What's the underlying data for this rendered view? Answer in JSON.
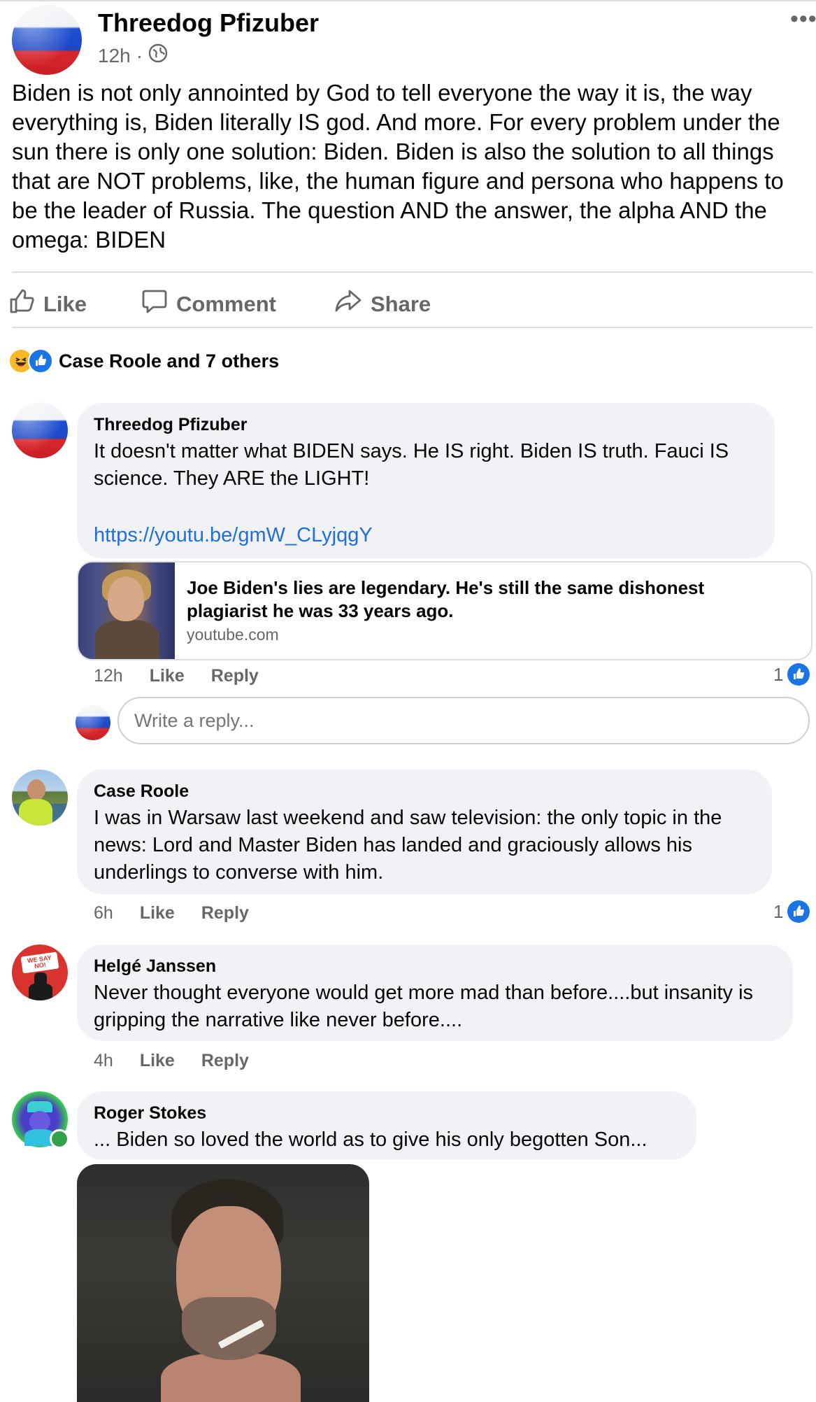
{
  "post": {
    "author": "Threedog Pfizuber",
    "time": "12h",
    "separator": "·",
    "text": "Biden is not only annointed by God to tell everyone the way it is, the way everything is, Biden literally IS god. And more. For every problem under the sun there is only one solution: Biden. Biden is also the solution to all things that are NOT problems, like, the human figure and persona who happens to be the leader of Russia. The question AND the answer, the alpha AND the omega: BIDEN",
    "more_icon": "more-horizontal-icon"
  },
  "actions": {
    "like": "Like",
    "comment": "Comment",
    "share": "Share"
  },
  "reactions": {
    "summary": "Case Roole and 7 others",
    "icons": [
      "haha-icon",
      "like-icon"
    ]
  },
  "comments": [
    {
      "author": "Threedog Pfizuber",
      "text": "It doesn't matter what BIDEN says. He IS right. Biden IS truth. Fauci IS science. They ARE the LIGHT!",
      "link": "https://youtu.be/gmW_CLyjqgY",
      "link_preview": {
        "title": "Joe Biden's lies are legendary. He's still the same dishonest plagiarist he was 33 years ago.",
        "domain": "youtube.com"
      },
      "time": "12h",
      "like_label": "Like",
      "reply_label": "Reply",
      "likes": "1"
    },
    {
      "author": "Case Roole",
      "text": "I was in Warsaw last weekend and saw television: the only topic in the news: Lord and Master Biden has landed and graciously allows his underlings to converse with him.",
      "time": "6h",
      "like_label": "Like",
      "reply_label": "Reply",
      "likes": "1"
    },
    {
      "author": "Helgé Janssen",
      "avatar_text": "WE SAY NO!",
      "text": "Never thought everyone would get more mad than before....but insanity is gripping the narrative like never before....",
      "time": "4h",
      "like_label": "Like",
      "reply_label": "Reply"
    },
    {
      "author": "Roger Stokes",
      "text": "... Biden so loved the world as to give his only begotten Son..."
    }
  ],
  "reply_box": {
    "placeholder": "Write a reply..."
  },
  "colors": {
    "accent": "#1b74e4",
    "bubble": "#f0f2f5",
    "secondary_text": "#65676b",
    "online": "#31a24c"
  }
}
